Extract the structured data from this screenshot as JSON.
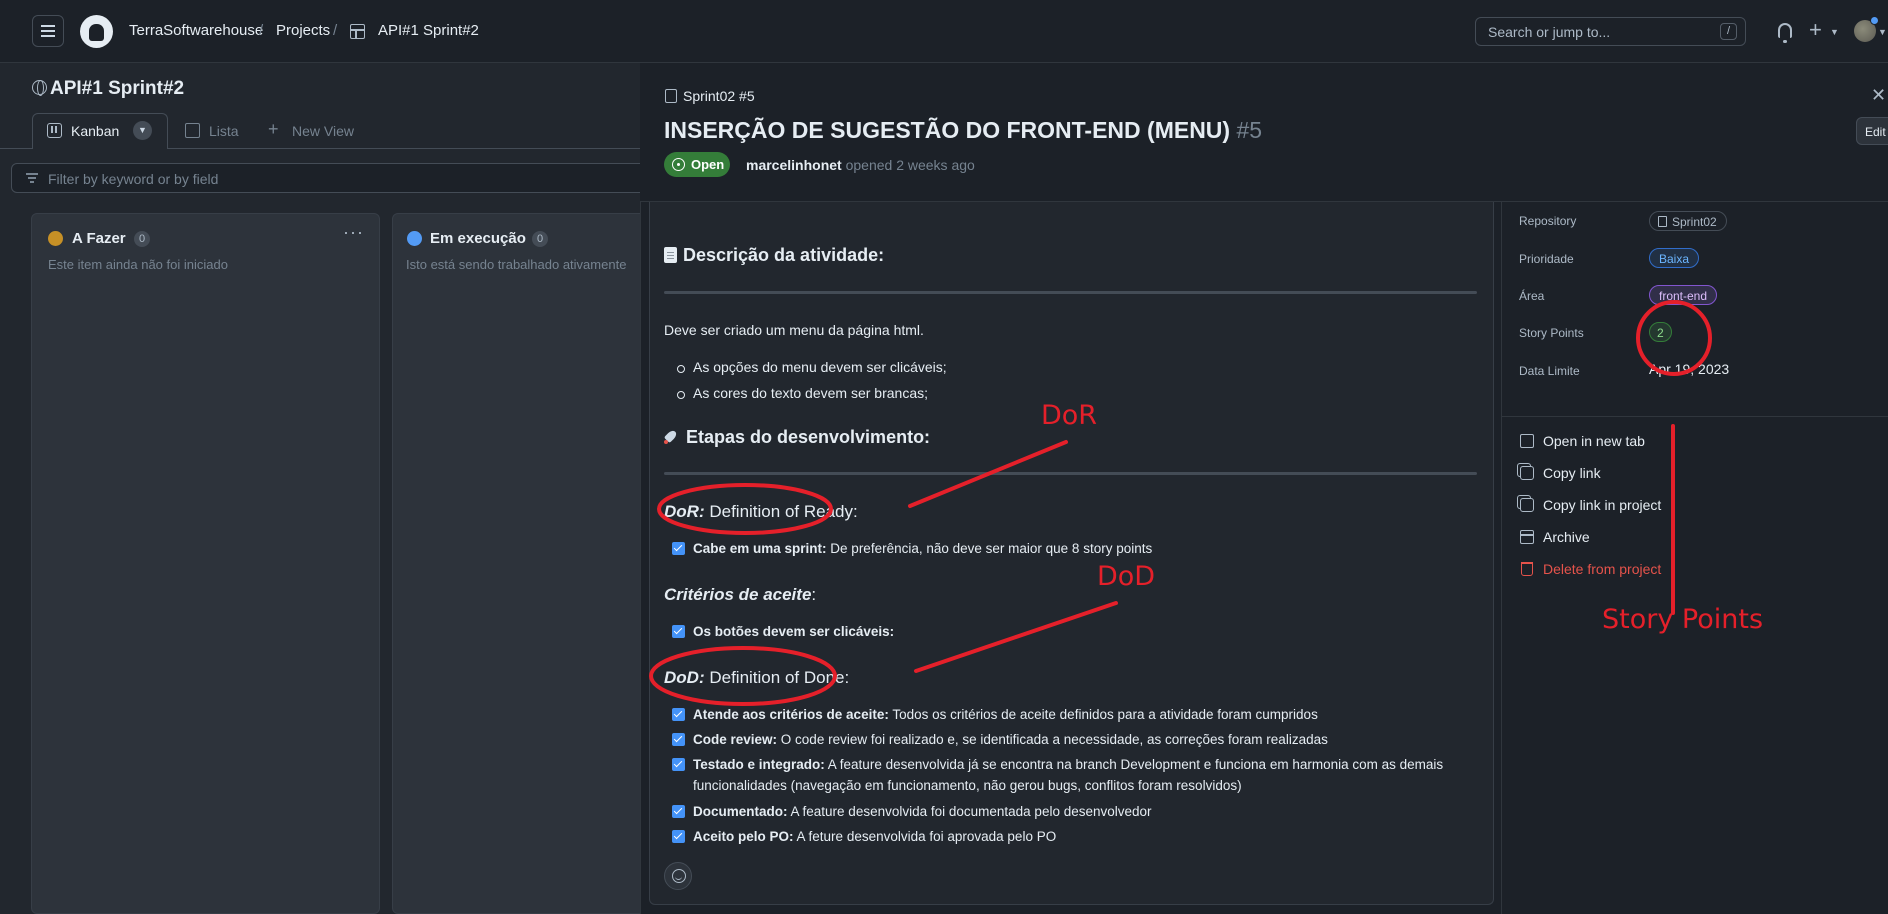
{
  "header": {
    "org": "TerraSoftwarehouse",
    "projects": "Projects",
    "project": "API#1 Sprint#2",
    "search_placeholder": "Search or jump to...",
    "search_shortcut": "/"
  },
  "project": {
    "title": "API#1 Sprint#2",
    "tabs": [
      {
        "label": "Kanban"
      },
      {
        "label": "Lista"
      },
      {
        "label": "New View"
      }
    ],
    "filter_placeholder": "Filter by keyword or by field"
  },
  "columns": [
    {
      "name": "A Fazer",
      "count": "0",
      "description": "Este item ainda não foi iniciado",
      "color": "#c69026"
    },
    {
      "name": "Em execução",
      "count": "0",
      "description": "Isto está sendo trabalhado ativamente",
      "color": "#539bf5"
    }
  ],
  "issue": {
    "ref": "Sprint02 #5",
    "title": "INSERÇÃO DE SUGESTÃO DO FRONT-END (MENU)",
    "number": "#5",
    "state": "Open",
    "author": "marcelinhonet",
    "opened": "opened 2 weeks ago",
    "edit_label": "Edit",
    "body": {
      "desc_heading": "Descrição da atividade:",
      "desc_text": "Deve ser criado um menu da página html.",
      "bullets": [
        "As opções do menu devem ser clicáveis;",
        "As cores do texto devem ser brancas;"
      ],
      "etapas_heading": "Etapas do desenvolvimento:",
      "dor_abbr": "DoR:",
      "dor_text": "Definition of Ready:",
      "dor_tasks": [
        {
          "bold": "Cabe em uma sprint:",
          "text": "De preferência, não deve ser maior que 8 story points"
        }
      ],
      "criteria_heading": "Critérios de aceite",
      "criteria_tasks": [
        {
          "bold": "Os botões devem ser clicáveis:",
          "text": ""
        }
      ],
      "dod_abbr": "DoD:",
      "dod_text": "Definition of Done:",
      "dod_tasks": [
        {
          "bold": "Atende aos critérios de aceite:",
          "text": "Todos os critérios de aceite definidos para a atividade foram cumpridos"
        },
        {
          "bold": "Code review:",
          "text": "O code review foi realizado e, se identificada a necessidade, as correções foram realizadas"
        },
        {
          "bold": "Testado e integrado:",
          "text": "A feature desenvolvida já se encontra na branch Development e funciona em harmonia com as demais funcionalidades (navegação em funcionamento, não gerou bugs, conflitos foram resolvidos)"
        },
        {
          "bold": "Documentado:",
          "text": "A feature desenvolvida foi documentada pelo desenvolvedor"
        },
        {
          "bold": "Aceito pelo PO:",
          "text": "A feture desenvolvida foi aprovada pelo PO"
        }
      ]
    }
  },
  "fields": {
    "repository_label": "Repository",
    "repository_value": "Sprint02",
    "priority_label": "Prioridade",
    "priority_value": "Baixa",
    "area_label": "Área",
    "area_value": "front-end",
    "story_points_label": "Story Points",
    "story_points_value": "2",
    "deadline_label": "Data Limite",
    "deadline_value": "Apr 19, 2023"
  },
  "actions": [
    {
      "label": "Open in new tab",
      "icon": "external-link-icon"
    },
    {
      "label": "Copy link",
      "icon": "copy-icon"
    },
    {
      "label": "Copy link in project",
      "icon": "copy-icon"
    },
    {
      "label": "Archive",
      "icon": "archive-icon"
    },
    {
      "label": "Delete from project",
      "icon": "trash-icon"
    }
  ],
  "annotations": {
    "dor": "DoR",
    "dod": "DoD",
    "story_points": "Story Points",
    "color": "#e5202a"
  }
}
